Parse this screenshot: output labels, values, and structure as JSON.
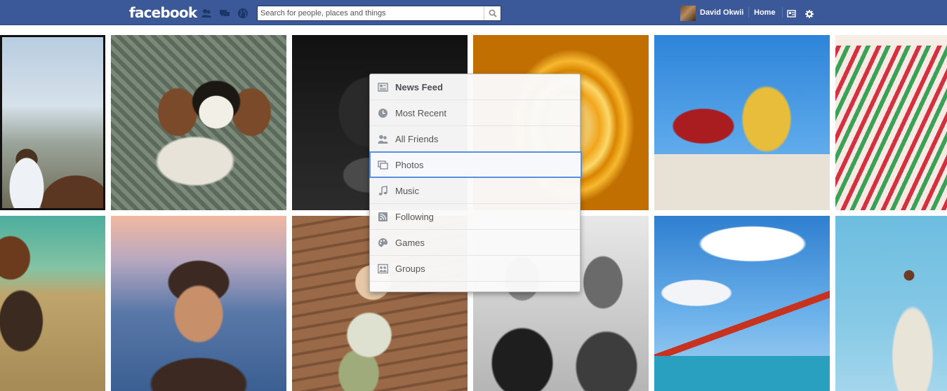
{
  "header": {
    "logo": "facebook",
    "search_placeholder": "Search for people, places and things",
    "user_name": "David Okwii",
    "home_label": "Home",
    "icons": [
      "friend-requests-icon",
      "messages-icon",
      "notifications-globe-icon",
      "search-icon",
      "privacy-shortcuts-icon",
      "settings-gear-icon"
    ]
  },
  "menu": {
    "items": [
      {
        "label": "News Feed",
        "icon": "news-feed-icon"
      },
      {
        "label": "Most Recent",
        "icon": "clock-icon"
      },
      {
        "label": "All Friends",
        "icon": "friends-icon"
      },
      {
        "label": "Photos",
        "icon": "photos-icon"
      },
      {
        "label": "Music",
        "icon": "music-note-icon"
      },
      {
        "label": "Following",
        "icon": "rss-feed-icon"
      },
      {
        "label": "Games",
        "icon": "gamepad-icon"
      },
      {
        "label": "Groups",
        "icon": "groups-icon"
      }
    ],
    "selected": "Photos"
  },
  "colors": {
    "brand": "#3b5998",
    "selection": "#5b8fe0"
  }
}
